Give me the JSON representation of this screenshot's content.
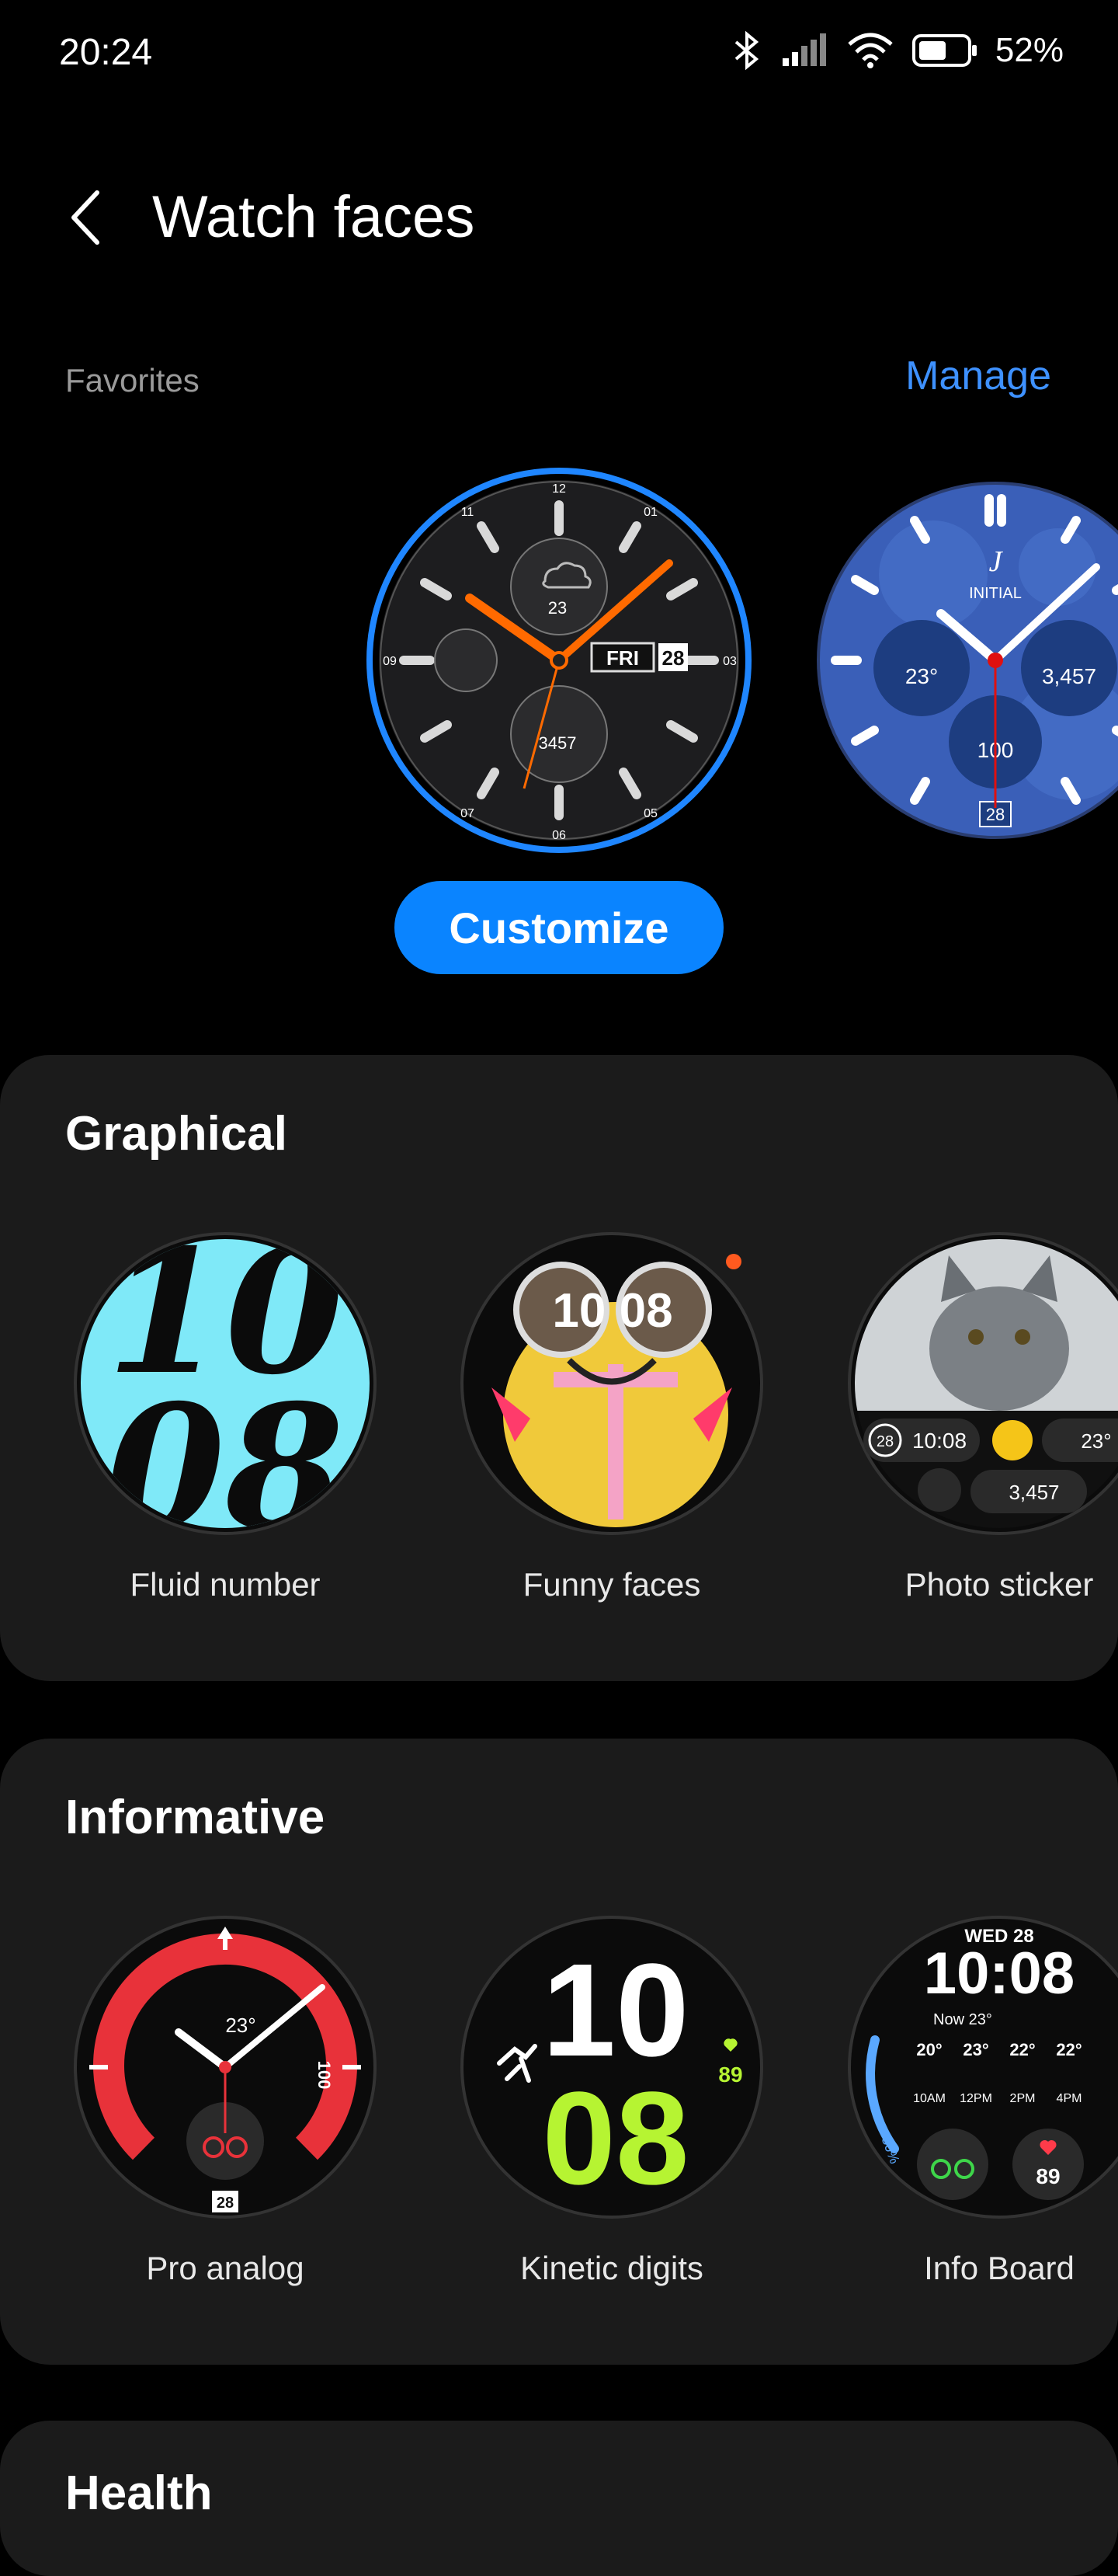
{
  "status_bar": {
    "time": "20:24",
    "battery": "52%",
    "icons": [
      "bluetooth-icon",
      "signal-icon",
      "wifi-icon",
      "battery-icon"
    ]
  },
  "header": {
    "back_icon": "chevron-left-icon",
    "title": "Watch faces"
  },
  "favorites": {
    "label": "Favorites",
    "manage": "Manage",
    "customize": "Customize",
    "faces": [
      {
        "name": "selected-favorite",
        "texts": {
          "day": "FRI",
          "date": "28",
          "temp": "23",
          "steps": "3457",
          "n12": "12",
          "n01": "01",
          "n05": "05",
          "n06": "06",
          "n07": "07",
          "n11": "11",
          "n09": "09",
          "n03": "03"
        }
      },
      {
        "name": "initial-favorite",
        "texts": {
          "brand": "INITIAL",
          "temp": "23°",
          "steps": "3,457",
          "hr": "100",
          "date": "28"
        }
      }
    ]
  },
  "sections": [
    {
      "title": "Graphical",
      "items": [
        {
          "label": "Fluid number",
          "texts": {
            "hh": "10",
            "mm": "08"
          }
        },
        {
          "label": "Funny faces",
          "texts": {
            "time": "10 08"
          }
        },
        {
          "label": "Photo sticker",
          "texts": {
            "date": "28",
            "time": "10:08",
            "temp": "23°",
            "steps": "3,457"
          }
        }
      ]
    },
    {
      "title": "Informative",
      "items": [
        {
          "label": "Pro analog",
          "texts": {
            "temp": "23°",
            "sub": "100",
            "date": "28"
          }
        },
        {
          "label": "Kinetic digits",
          "texts": {
            "hh": "10",
            "mm": "08",
            "hr": "89"
          }
        },
        {
          "label": "Info Board",
          "texts": {
            "day": "WED 28",
            "time": "10:08",
            "now": "Now 23°",
            "t1": "20°",
            "t2": "23°",
            "t3": "22°",
            "t4": "22°",
            "h1": "10AM",
            "h2": "12PM",
            "h3": "2PM",
            "h4": "4PM",
            "battery": "30%",
            "hr": "89"
          }
        }
      ]
    },
    {
      "title": "Health"
    }
  ],
  "colors": {
    "accent": "#3e91ff",
    "button": "#0a84ff",
    "card": "#1b1b1b",
    "fluid": "#7fe9f8",
    "kinetic": "#b6f432",
    "pro_red": "#e8323a"
  }
}
